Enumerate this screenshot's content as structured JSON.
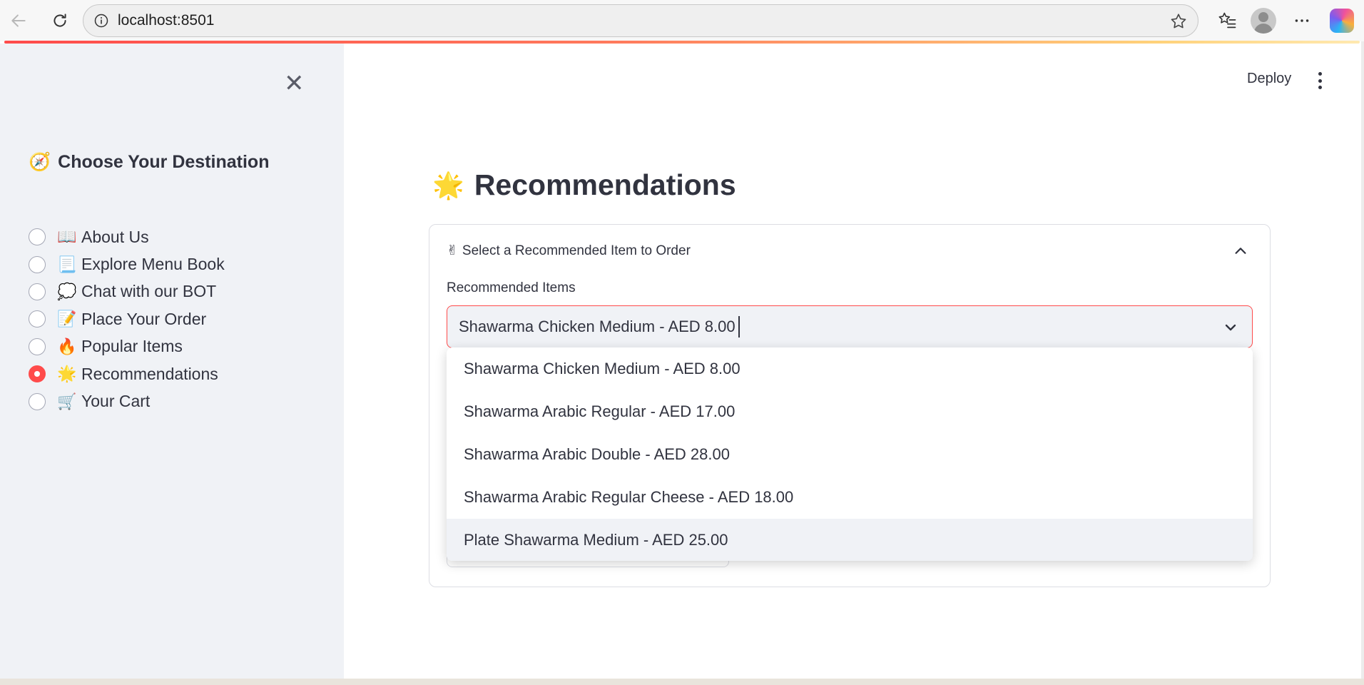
{
  "browser": {
    "url": "localhost:8501"
  },
  "sidebar": {
    "title": "Choose Your Destination",
    "title_emoji": "🧭",
    "items": [
      {
        "emoji": "📖",
        "label": "About Us",
        "selected": false
      },
      {
        "emoji": "📃",
        "label": "Explore Menu Book",
        "selected": false
      },
      {
        "emoji": "💭",
        "label": "Chat with our BOT",
        "selected": false
      },
      {
        "emoji": "📝",
        "label": "Place Your Order",
        "selected": false
      },
      {
        "emoji": "🔥",
        "label": "Popular Items",
        "selected": false
      },
      {
        "emoji": "🌟",
        "label": "Recommendations",
        "selected": true
      },
      {
        "emoji": "🛒",
        "label": "Your Cart",
        "selected": false
      }
    ]
  },
  "header": {
    "deploy_label": "Deploy"
  },
  "main": {
    "title": "Recommendations",
    "title_emoji": "🌟",
    "expander": {
      "emoji": "✌",
      "label": "Select a Recommended Item to Order",
      "field_label": "Recommended Items",
      "selected_value": "Shawarma Chicken Medium - AED 8.00"
    },
    "dropdown": {
      "options": [
        "Shawarma Chicken Medium - AED 8.00",
        "Shawarma Arabic Regular - AED 17.00",
        "Shawarma Arabic Double - AED 28.00",
        "Shawarma Arabic Regular Cheese - AED 18.00",
        "Plate Shawarma Medium - AED 25.00"
      ],
      "hovered_index": 4
    }
  },
  "colors": {
    "accent": "#ff4b4b",
    "sidebar_bg": "#f0f2f6",
    "text": "#31333f"
  }
}
